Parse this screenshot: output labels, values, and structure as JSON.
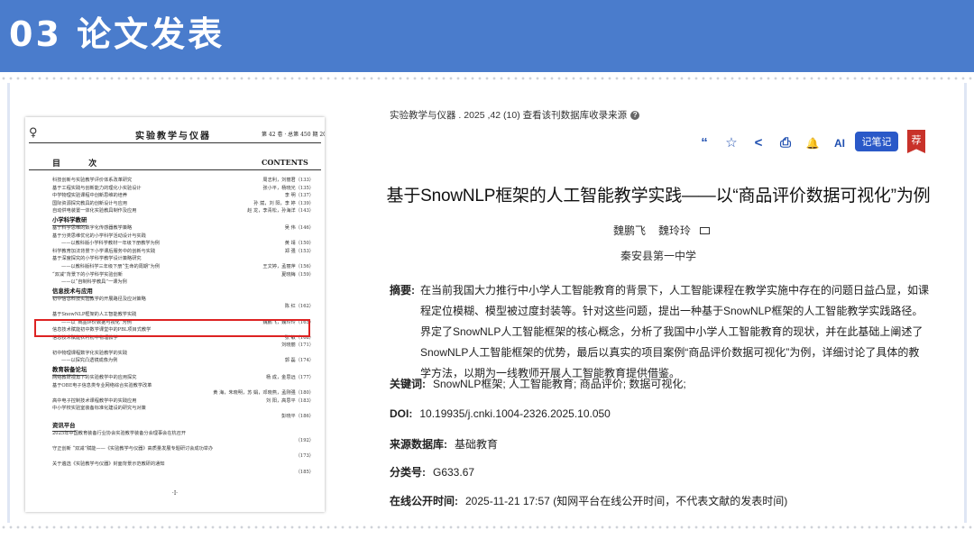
{
  "slide": {
    "title": "03 论文发表"
  },
  "journal_page": {
    "logo_icon": "journal-logo-icon",
    "journal_name": "实验教学与仪器",
    "issue_info": "第 42 卷 · 总第 450 期 2025 年 10 月",
    "contents_cn": "目 次",
    "contents_en": "CONTENTS",
    "page_number": "·Ⅰ·",
    "rows": [
      {
        "kind": "item",
        "title": "科技创新与实验教学评价体系改革研究",
        "authors": "周志利，刘丽君（133）"
      },
      {
        "kind": "item",
        "title": "基于工程实践与创新能力的理化小实验设计",
        "authors": "张小平，杨晓光（135）"
      },
      {
        "kind": "item",
        "title": "中学物理实验课程中创新思维的培养",
        "authors": "李 明（137）"
      },
      {
        "kind": "item",
        "title": "国际资源探究教具的创新设计与应用",
        "authors": "孙 斌，刘 阳，李 婷（139）"
      },
      {
        "kind": "item",
        "title": "自动供电装置一体化实验教具制作及应用",
        "authors": "赵 龙，李青松，孙海洋（143）"
      },
      {
        "kind": "section",
        "title": "小学科学教研",
        "authors": ""
      },
      {
        "kind": "item",
        "title": "基于科学思维的数字化传感器教学策略",
        "authors": "吴 伟（146）"
      },
      {
        "kind": "item",
        "title": "基于分类思维优化的小学科学活动设计与实践",
        "authors": ""
      },
      {
        "kind": "sub",
        "title": "——以教科版小学科学教材一年级下册教学为例",
        "authors": "黄 靖（150）"
      },
      {
        "kind": "item",
        "title": "科学教育加法背景下小学课后服务中的创新与实践",
        "authors": "郑 强（153）"
      },
      {
        "kind": "item",
        "title": "基于深度探究的小学科学教学设计策略研究",
        "authors": ""
      },
      {
        "kind": "sub",
        "title": "——以教科版科学三年级下册“生命的周期”为例",
        "authors": "王文婷，孟丽萍（156）"
      },
      {
        "kind": "item",
        "title": "“双减”背景下的小学科学实验创新",
        "authors": "夏晓梅（159）"
      },
      {
        "kind": "sub",
        "title": "——以“自制科学教具”一课为例",
        "authors": ""
      },
      {
        "kind": "section",
        "title": "信息技术与应用",
        "authors": ""
      },
      {
        "kind": "item",
        "title": "初中信息科技实验教学的开展路径及应对策略",
        "authors": ""
      },
      {
        "kind": "item",
        "title": "",
        "authors": "陈 红（162）"
      },
      {
        "kind": "item",
        "title": "基于SnowNLP框架的人工智能教学实践",
        "authors": ""
      },
      {
        "kind": "sub",
        "title": "——以“商品评价数据可视化”为例",
        "authors": "魏鹏飞，魏玲玲（165）"
      },
      {
        "kind": "item",
        "title": "信息技术赋能初中数学课堂中的PBL项目式教学",
        "authors": ""
      },
      {
        "kind": "item",
        "title": "信息技术赋能农村初中物理教学",
        "authors": "张 敏（168）"
      },
      {
        "kind": "item",
        "title": "",
        "authors": "刘晓丽（171）"
      },
      {
        "kind": "item",
        "title": "初中物理课程数字化实验教学的实践",
        "authors": ""
      },
      {
        "kind": "sub",
        "title": "——以探究凸透镜成像为例",
        "authors": "郭 磊（174）"
      },
      {
        "kind": "section",
        "title": "教育装备论坛",
        "authors": ""
      },
      {
        "kind": "item",
        "title": "网络教研视角下的实验教学中的应用探究",
        "authors": "杨 成，金思远（177）"
      },
      {
        "kind": "item",
        "title": "基于OBE电子信息类专业网络综合实验教学改革",
        "authors": ""
      },
      {
        "kind": "item",
        "title": "",
        "authors": "黄 海，朱晓明，苏 娟，邓晓燕，孟刚强（180）"
      },
      {
        "kind": "item",
        "title": "高中电子控制技术课程教学中的实践应用",
        "authors": "刘 阳，高思平（183）"
      },
      {
        "kind": "item",
        "title": "中小学校实验室装备标准化建设的研究与对策",
        "authors": ""
      },
      {
        "kind": "item",
        "title": "",
        "authors": "彭晓平（186）"
      },
      {
        "kind": "section",
        "title": "资讯平台",
        "authors": ""
      },
      {
        "kind": "item",
        "title": "2025年中国教育装备行业协会实验教学装备分会理事会在杭召开",
        "authors": ""
      },
      {
        "kind": "item",
        "title": "",
        "authors": "（192）"
      },
      {
        "kind": "item",
        "title": "守正创新 “双减”赋能——《实验教学与仪器》高质量发展专题研讨会成功举办",
        "authors": ""
      },
      {
        "kind": "item",
        "title": "",
        "authors": "（173）"
      },
      {
        "kind": "item",
        "title": "关于遴选《实验教学与仪器》封面背景示范教研的通知",
        "authors": ""
      },
      {
        "kind": "item",
        "title": "",
        "authors": "（185）"
      }
    ]
  },
  "article": {
    "source_line": "实验教学与仪器 . 2025 ,42 (10) 查看该刊数据库收录来源",
    "help_icon": "help-circle-icon",
    "toolbar": [
      {
        "icon": "quote-icon",
        "glyph": "“"
      },
      {
        "icon": "favorite-icon",
        "glyph": "☆"
      },
      {
        "icon": "share-icon",
        "glyph": "<"
      },
      {
        "icon": "print-icon",
        "glyph": "⎙"
      },
      {
        "icon": "notification-bell-icon",
        "glyph": "🔔"
      },
      {
        "icon": "ai-assistant-icon",
        "glyph": "AI"
      }
    ],
    "note_button": "记笔记",
    "recommend_badge": "荐",
    "title": "基于SnowNLP框架的人工智能教学实践——以“商品评价数据可视化”为例",
    "authors": [
      "魏鹏飞",
      "魏玲玲"
    ],
    "organization": "秦安县第一中学",
    "abstract_label": "摘要:",
    "abstract_text": "在当前我国大力推行中小学人工智能教育的背景下，人工智能课程在教学实施中存在的问题日益凸显，如课程定位模糊、模型被过度封装等。针对这些问题，提出一种基于SnowNLP框架的人工智能教学实践路径。界定了SnowNLP人工智能框架的核心概念，分析了我国中小学人工智能教育的现状，并在此基础上阐述了SnowNLP人工智能框架的优势，最后以真实的项目案例“商品评价数据可视化”为例，详细讨论了具体的教学方法，以期为一线教师开展人工智能教育提供借鉴。",
    "keywords_label": "关键词:",
    "keywords": "SnowNLP框架; 人工智能教育; 商品评价; 数据可视化;",
    "doi_label": "DOI:",
    "doi": "10.19935/j.cnki.1004-2326.2025.10.050",
    "database_label": "来源数据库:",
    "database": "基础教育",
    "class_label": "分类号:",
    "class_number": "G633.67",
    "online_label": "在线公开时间:",
    "online_date": "2025-11-21 17:57",
    "online_note": "(知网平台在线公开时间，不代表文献的发表时间)"
  }
}
